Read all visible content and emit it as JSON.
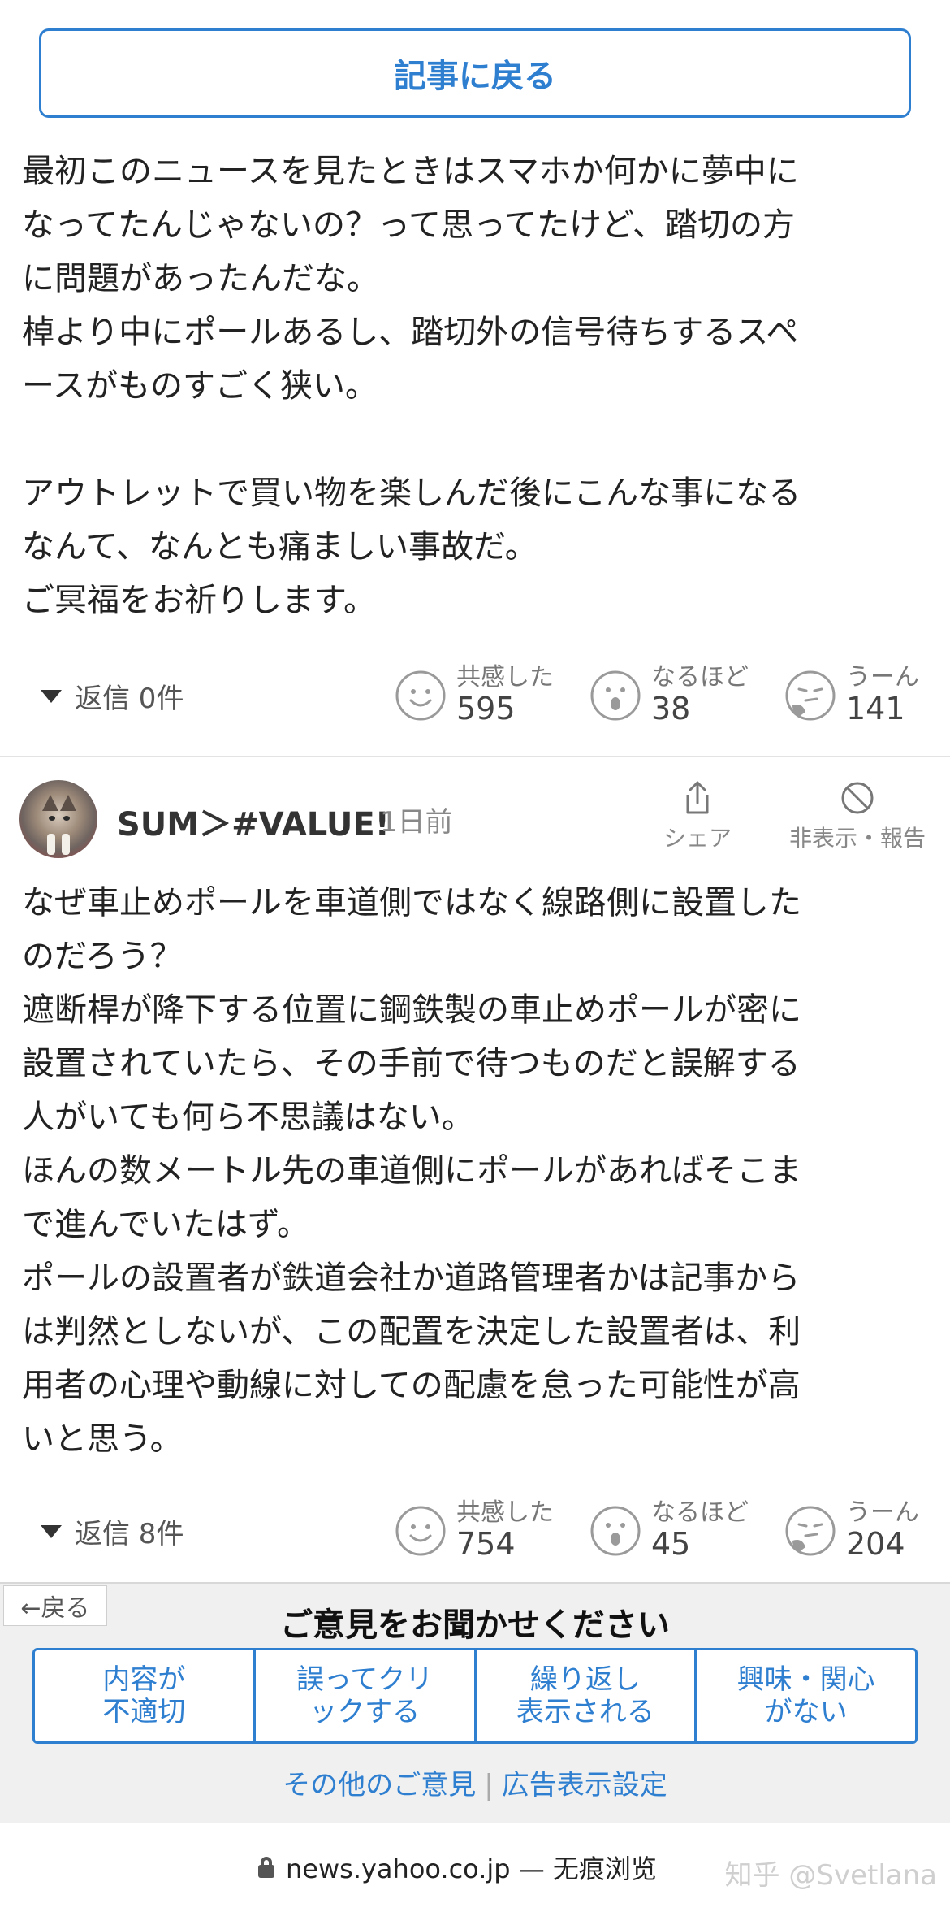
{
  "back_to_article": "記事に戻る",
  "comments": [
    {
      "body": "最初このニュースを見たときはスマホか何かに夢中に\nなってたんじゃないの？って思ってたけど、踏切の方\nに問題があったんだな。\n棹より中にポールあるし、踏切外の信号待ちするスペ\nースがものすごく狭い。\n\nアウトレットで買い物を楽しんだ後にこんな事になる\nなんて、なんとも痛ましい事故だ。\nご冥福をお祈りします。",
      "replies": "返信 0件",
      "reactions": {
        "empathy": {
          "label": "共感した",
          "count": "595"
        },
        "naruhodo": {
          "label": "なるほど",
          "count": "38"
        },
        "uun": {
          "label": "うーん",
          "count": "141"
        }
      }
    },
    {
      "author": "SUM＞#VALUE!",
      "time": "1日前",
      "share_label": "シェア",
      "hide_report_label": "非表示・報告",
      "body": "なぜ車止めポールを車道側ではなく線路側に設置した\nのだろう？\n遮断桿が降下する位置に鋼鉄製の車止めポールが密に\n設置されていたら、その手前で待つものだと誤解する\n人がいても何ら不思議はない。\nほんの数メートル先の車道側にポールがあればそこま\nで進んでいたはず。\nポールの設置者が鉄道会社か道路管理者かは記事から\nは判然としないが、この配置を決定した設置者は、利\n用者の心理や動線に対しての配慮を怠った可能性が高\nいと思う。",
      "replies": "返信 8件",
      "reactions": {
        "empathy": {
          "label": "共感した",
          "count": "754"
        },
        "naruhodo": {
          "label": "なるほど",
          "count": "45"
        },
        "uun": {
          "label": "うーん",
          "count": "204"
        }
      }
    }
  ],
  "survey": {
    "back_label": "←戻る",
    "title": "ご意見をお聞かせください",
    "options": [
      "内容が\n不適切",
      "誤ってクリ\nックする",
      "繰り返し\n表示される",
      "興味・関心\nがない"
    ],
    "other_link": "その他のご意見",
    "ad_settings_link": "広告表示設定"
  },
  "browser": {
    "url": "news.yahoo.co.jp — 无痕浏览",
    "watermark": "知乎 @Svetlana"
  },
  "colors": {
    "accent": "#2f7fd1",
    "text": "#222222",
    "muted": "#888888"
  }
}
